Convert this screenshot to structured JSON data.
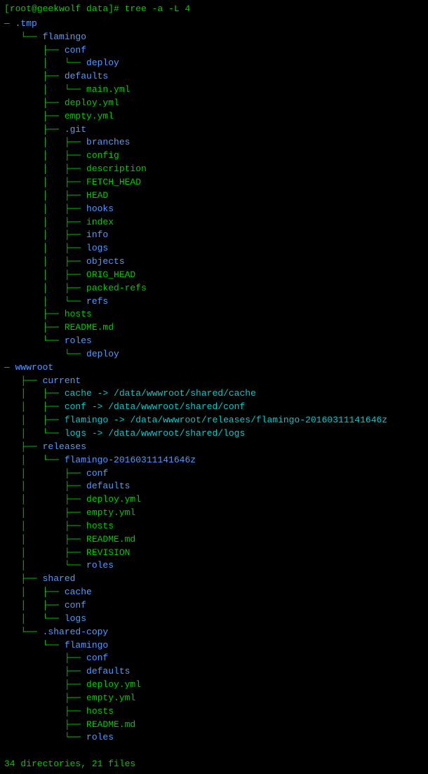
{
  "terminal": {
    "prompt": "[root@geekwolf data]# tree  -a -L 4",
    "summary": "34 directories, 21 files",
    "lines": [
      {
        "text": ".tmp",
        "indent": 0,
        "type": "dir",
        "prefix": ""
      },
      {
        "text": "flamingo",
        "indent": 1,
        "type": "dir"
      },
      {
        "text": "conf",
        "indent": 2,
        "type": "dir"
      },
      {
        "text": "deploy",
        "indent": 3,
        "type": "dir"
      },
      {
        "text": "defaults",
        "indent": 2,
        "type": "dir"
      },
      {
        "text": "main.yml",
        "indent": 3,
        "type": "file"
      },
      {
        "text": "deploy.yml",
        "indent": 2,
        "type": "file"
      },
      {
        "text": "empty.yml",
        "indent": 2,
        "type": "file"
      },
      {
        "text": ".git",
        "indent": 2,
        "type": "dir"
      },
      {
        "text": "branches",
        "indent": 3,
        "type": "dir"
      },
      {
        "text": "config",
        "indent": 3,
        "type": "file"
      },
      {
        "text": "description",
        "indent": 3,
        "type": "file"
      },
      {
        "text": "FETCH_HEAD",
        "indent": 3,
        "type": "file"
      },
      {
        "text": "HEAD",
        "indent": 3,
        "type": "file"
      },
      {
        "text": "hooks",
        "indent": 3,
        "type": "dir"
      },
      {
        "text": "index",
        "indent": 3,
        "type": "file"
      },
      {
        "text": "info",
        "indent": 3,
        "type": "dir"
      },
      {
        "text": "logs",
        "indent": 3,
        "type": "dir"
      },
      {
        "text": "objects",
        "indent": 3,
        "type": "dir"
      },
      {
        "text": "ORIG_HEAD",
        "indent": 3,
        "type": "file"
      },
      {
        "text": "packed-refs",
        "indent": 3,
        "type": "file"
      },
      {
        "text": "refs",
        "indent": 3,
        "type": "dir"
      },
      {
        "text": "hosts",
        "indent": 2,
        "type": "file"
      },
      {
        "text": "README.md",
        "indent": 2,
        "type": "file"
      },
      {
        "text": "roles",
        "indent": 2,
        "type": "dir"
      },
      {
        "text": "deploy",
        "indent": 3,
        "type": "dir"
      },
      {
        "text": "wwwroot",
        "indent": 0,
        "type": "dir"
      },
      {
        "text": "current",
        "indent": 1,
        "type": "dir"
      },
      {
        "text": "cache -> /data/wwwroot/shared/cache",
        "indent": 2,
        "type": "link"
      },
      {
        "text": "conf -> /data/wwwroot/shared/conf",
        "indent": 2,
        "type": "link"
      },
      {
        "text": "flamingo -> /data/wwwroot/releases/flamingo-20160311141646z",
        "indent": 2,
        "type": "link"
      },
      {
        "text": "logs -> /data/wwwroot/shared/logs",
        "indent": 2,
        "type": "link"
      },
      {
        "text": "releases",
        "indent": 1,
        "type": "dir"
      },
      {
        "text": "flamingo-20160311141646z",
        "indent": 2,
        "type": "dir"
      },
      {
        "text": "conf",
        "indent": 3,
        "type": "dir"
      },
      {
        "text": "defaults",
        "indent": 3,
        "type": "dir"
      },
      {
        "text": "deploy.yml",
        "indent": 3,
        "type": "file"
      },
      {
        "text": "empty.yml",
        "indent": 3,
        "type": "file"
      },
      {
        "text": "hosts",
        "indent": 3,
        "type": "file"
      },
      {
        "text": "README.md",
        "indent": 3,
        "type": "file"
      },
      {
        "text": "REVISION",
        "indent": 3,
        "type": "file"
      },
      {
        "text": "roles",
        "indent": 3,
        "type": "dir"
      },
      {
        "text": "shared",
        "indent": 1,
        "type": "dir"
      },
      {
        "text": "cache",
        "indent": 2,
        "type": "dir"
      },
      {
        "text": "conf",
        "indent": 2,
        "type": "dir"
      },
      {
        "text": "logs",
        "indent": 2,
        "type": "dir"
      },
      {
        "text": ".shared-copy",
        "indent": 1,
        "type": "dir"
      },
      {
        "text": "flamingo",
        "indent": 2,
        "type": "dir"
      },
      {
        "text": "conf",
        "indent": 3,
        "type": "dir"
      },
      {
        "text": "defaults",
        "indent": 3,
        "type": "dir"
      },
      {
        "text": "deploy.yml",
        "indent": 3,
        "type": "file"
      },
      {
        "text": "empty.yml",
        "indent": 3,
        "type": "file"
      },
      {
        "text": "hosts",
        "indent": 3,
        "type": "file"
      },
      {
        "text": "README.md",
        "indent": 3,
        "type": "file"
      },
      {
        "text": "roles",
        "indent": 3,
        "type": "dir"
      }
    ]
  }
}
